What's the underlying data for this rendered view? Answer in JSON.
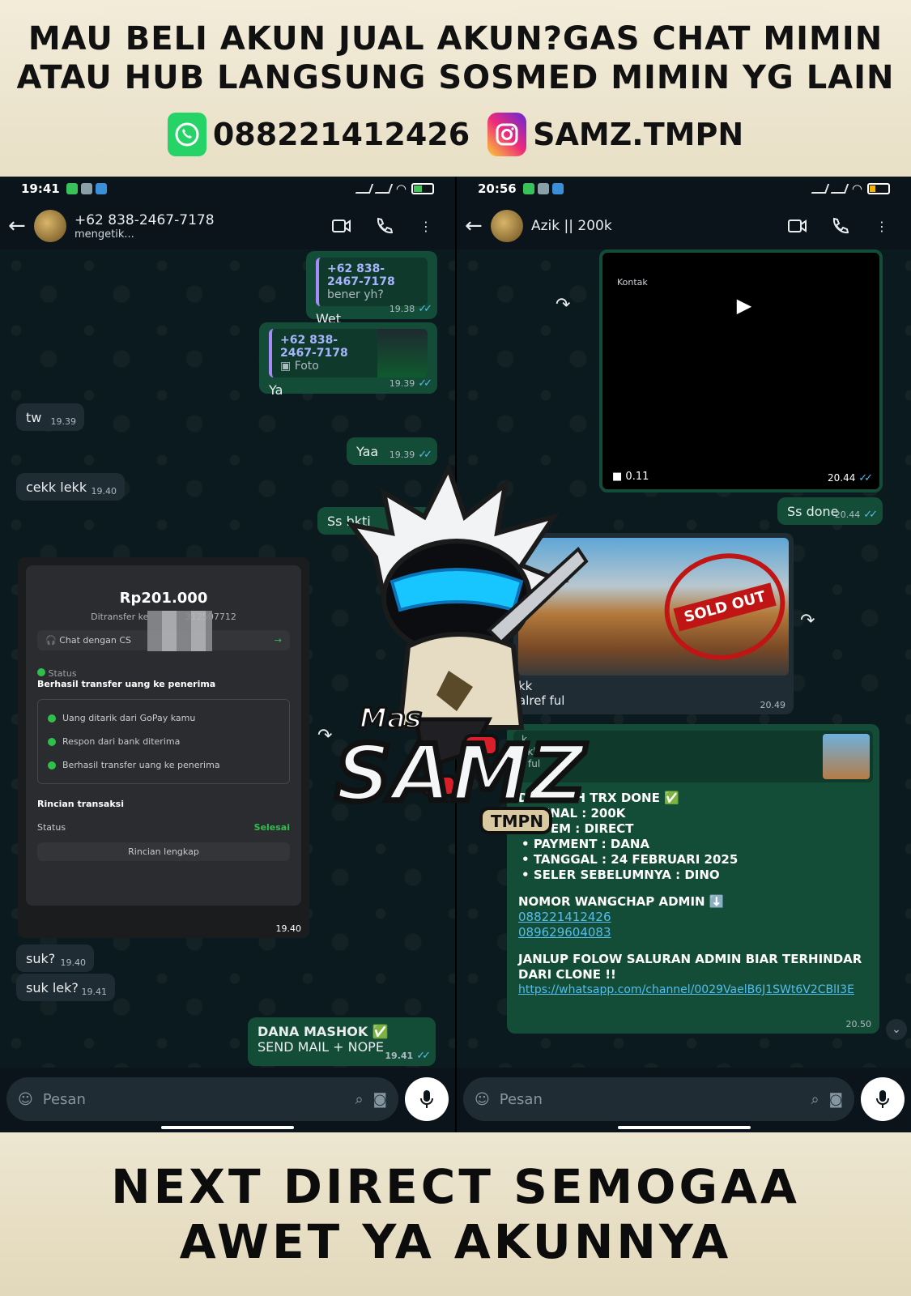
{
  "banner": {
    "headline_line1": "MAU BELI AKUN JUAL AKUN?GAS CHAT MIMIN",
    "headline_line2": "ATAU HUB LANGSUNG SOSMED MIMIN YG LAIN",
    "whatsapp_number": "088221412426",
    "instagram_handle": "SAMZ.TMPN",
    "footer_line1": "NEXT DIRECT SEMOGAA",
    "footer_line2": "AWET YA AKUNNYA"
  },
  "left_chat": {
    "status_time": "19:41",
    "contact_name": "+62 838-2467-7178",
    "contact_status": "mengetik...",
    "messages": {
      "m1_quote_name": "+62 838-2467-7178",
      "m1_quote_text": "bener yh?",
      "m1_text": "Wet",
      "m1_time": "19.38",
      "m2_quote_name": "+62 838-2467-7178",
      "m2_quote_text": "Foto",
      "m2_text": "Ya",
      "m2_time": "19.39",
      "m3_text": "tw",
      "m3_time": "19.39",
      "m4_text": "Yaa",
      "m4_time": "19.39",
      "m5_text": "cekk lekk",
      "m5_time": "19.40",
      "m6_text": "Ss bkti",
      "receipt_time": "19.40",
      "m7_text": "suk?",
      "m7_time": "19.40",
      "m8_text": "suk lek?",
      "m8_time": "19.41",
      "m9_line1": "DANA MASHOK ✅",
      "m9_line2": "SEND MAIL + NOPE",
      "m9_time": "19.41"
    },
    "receipt": {
      "amount": "Rp201.000",
      "transferred_to": "Ditransfer ke",
      "account_suffix": "312507712",
      "chat_cs": "Chat dengan CS",
      "status_label": "Status",
      "status_value": "Berhasil transfer uang ke penerima",
      "step1": "Uang ditarik dari GoPay kamu",
      "step2": "Respon dari bank diterima",
      "step3": "Berhasil transfer uang ke penerima",
      "details_title": "Rincian transaksi",
      "status_row_label": "Status",
      "status_row_value": "Selesai",
      "details_link": "Rincian lengkap"
    },
    "composer_placeholder": "Pesan"
  },
  "right_chat": {
    "status_time": "20:56",
    "contact_name": "Azik || 200k",
    "video": {
      "kontak_title": "Kontak",
      "duration": "0.11",
      "time": "20.44"
    },
    "ss_done_text": "Ss done",
    "ss_done_time": "20.44",
    "game_caption_1": "kk",
    "game_caption_2": "alref ful",
    "game_time": "20.49",
    "stamp_text": "SOLD OUT",
    "info": {
      "ref_line1": "k",
      "ref_line2": "ekk",
      "ref_line3": "f ful",
      "title": "DULILLAH TRX DONE ✅",
      "line_nominal": "MINAL : 200K",
      "line_sistem": "STEM : DIRECT",
      "line_payment": "PAYMENT : DANA",
      "line_tanggal": "TANGGAL : 24 FEBRUARI 2025",
      "line_seler": "SELER SEBELUMNYA : DINO",
      "admin_title": "NOMOR WANGCHAP ADMIN ⬇️",
      "admin_number1": "088221412426",
      "admin_number2": "089629604083",
      "follow_text": "JANLUP FOLOW SALURAN ADMIN BIAR TERHINDAR DARI CLONE !!",
      "channel_link": "https://whatsapp.com/channel/0029VaelB6J1SWt6V2CBlI3E",
      "time": "20.50"
    },
    "composer_placeholder": "Pesan"
  },
  "mascot": {
    "line1": "Mas",
    "line2": "SAMZ",
    "line3": "TMPN"
  },
  "colors": {
    "wa_green": "#25d366",
    "bubble_out": "#144d37",
    "bubble_in": "#202c33",
    "link_blue": "#53bdeb",
    "stamp_red": "#c01515"
  }
}
